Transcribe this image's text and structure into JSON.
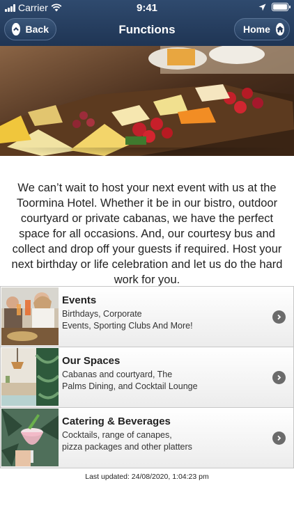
{
  "status_bar": {
    "carrier": "Carrier",
    "time": "9:41"
  },
  "nav": {
    "title": "Functions",
    "back_label": "Back",
    "home_label": "Home"
  },
  "intro_text": "We can’t wait to host your next event with us at the Toormina Hotel. Whether it be in our bistro, outdoor courtyard or private cabanas, we have the perfect space for all occasions. And, our courtesy bus and collect and drop off your guests if required. Host your next birthday or life celebration and let us do the hard work for you.",
  "items": [
    {
      "title": "Events",
      "subtitle": "Birthdays, Corporate\nEvents, Sporting Clubs And More!"
    },
    {
      "title": "Our Spaces",
      "subtitle": "Cabanas and courtyard, The\nPalms Dining, and Cocktail Lounge"
    },
    {
      "title": "Catering & Beverages",
      "subtitle": "Cocktails, range of canapes,\npizza packages and other platters"
    }
  ],
  "footer": {
    "last_updated": "Last updated: 24/08/2020, 1:04:23 pm"
  },
  "colors": {
    "nav_bg": "#24395a",
    "chevron": "#6b6b6b"
  }
}
